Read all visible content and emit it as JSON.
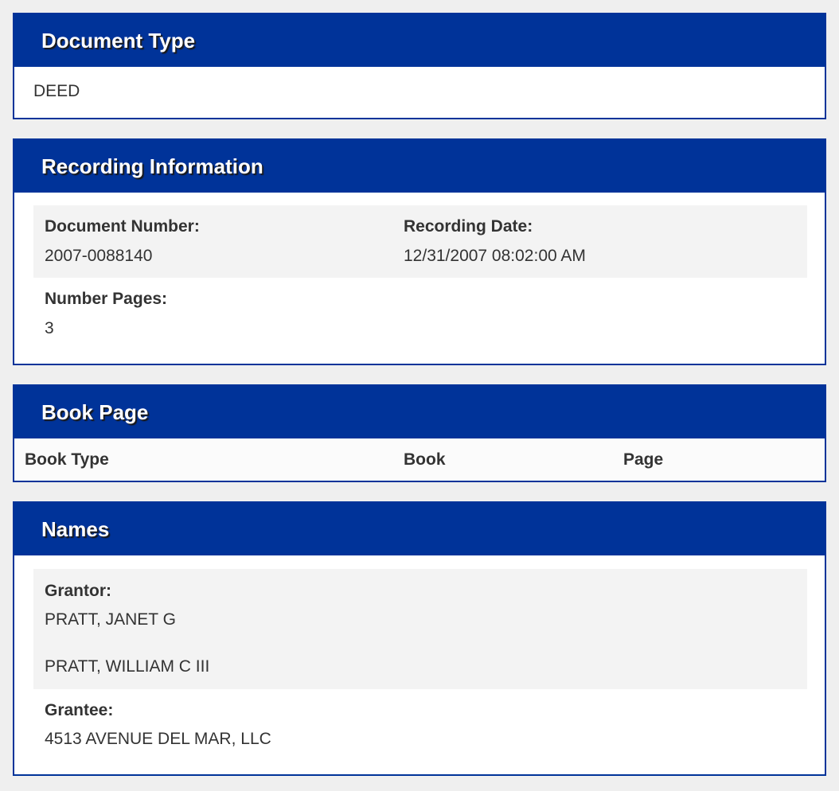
{
  "document_type": {
    "title": "Document Type",
    "value": "DEED"
  },
  "recording_information": {
    "title": "Recording Information",
    "document_number_label": "Document Number:",
    "document_number": "2007-0088140",
    "recording_date_label": "Recording Date:",
    "recording_date": "12/31/2007 08:02:00 AM",
    "number_pages_label": "Number Pages:",
    "number_pages": "3"
  },
  "book_page": {
    "title": "Book Page",
    "columns": [
      "Book Type",
      "Book",
      "Page"
    ]
  },
  "names": {
    "title": "Names",
    "grantor_label": "Grantor:",
    "grantors": [
      "PRATT, JANET G",
      "PRATT, WILLIAM C III"
    ],
    "grantee_label": "Grantee:",
    "grantees": [
      "4513 AVENUE DEL MAR, LLC"
    ]
  },
  "colors": {
    "header_blue": "#003399",
    "background": "#efefef",
    "row_shade": "#f3f3f3",
    "text": "#333333"
  }
}
